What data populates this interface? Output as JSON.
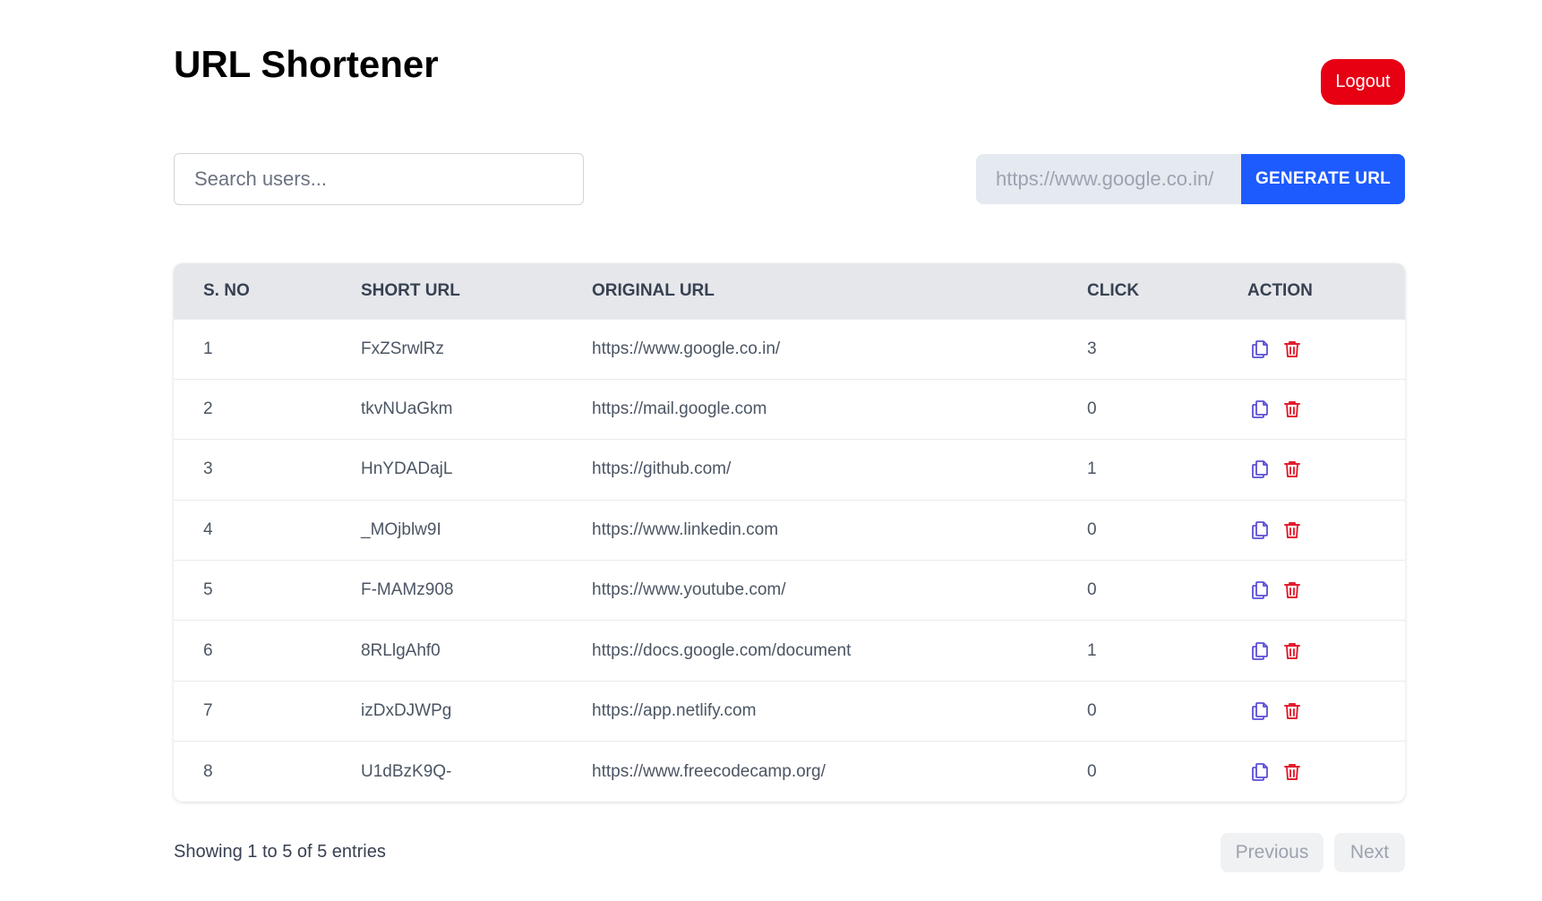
{
  "header": {
    "title": "URL Shortener",
    "logout_label": "Logout"
  },
  "search": {
    "placeholder": "Search users..."
  },
  "generator": {
    "url_value": "https://www.google.co.in/",
    "button_label": "GENERATE URL"
  },
  "table": {
    "columns": [
      "S. NO",
      "SHORT URL",
      "ORIGINAL URL",
      "CLICK",
      "ACTION"
    ],
    "rows": [
      {
        "sno": "1",
        "short": "FxZSrwlRz",
        "original": "https://www.google.co.in/",
        "clicks": "3"
      },
      {
        "sno": "2",
        "short": "tkvNUaGkm",
        "original": "https://mail.google.com",
        "clicks": "0"
      },
      {
        "sno": "3",
        "short": "HnYDADajL",
        "original": "https://github.com/",
        "clicks": "1"
      },
      {
        "sno": "4",
        "short": "_MOjblw9I",
        "original": "https://www.linkedin.com",
        "clicks": "0"
      },
      {
        "sno": "5",
        "short": "F-MAMz908",
        "original": "https://www.youtube.com/",
        "clicks": "0"
      },
      {
        "sno": "6",
        "short": "8RLlgAhf0",
        "original": "https://docs.google.com/document",
        "clicks": "1"
      },
      {
        "sno": "7",
        "short": "izDxDJWPg",
        "original": "https://app.netlify.com",
        "clicks": "0"
      },
      {
        "sno": "8",
        "short": "U1dBzK9Q-",
        "original": "https://www.freecodecamp.org/",
        "clicks": "0"
      }
    ],
    "action_icons": [
      "copy-icon",
      "trash-icon"
    ]
  },
  "pagination": {
    "info": "Showing 1 to 5 of 5 entries",
    "previous_label": "Previous",
    "next_label": "Next"
  },
  "colors": {
    "logout": "#e60012",
    "generate": "#1d5bff",
    "copy_icon": "#5b4fd6",
    "trash_icon": "#e11d2f",
    "header_row": "#e5e7eb"
  }
}
